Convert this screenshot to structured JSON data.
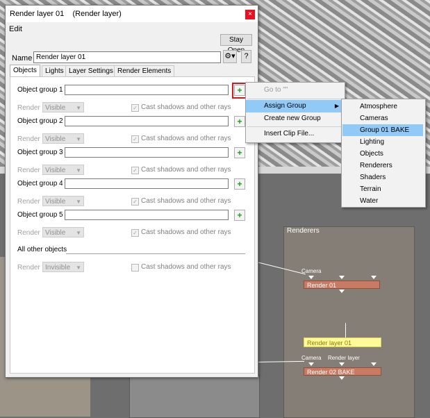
{
  "dialog": {
    "title": "Render layer 01    (Render layer)",
    "close_glyph": "×",
    "menu_edit": "Edit",
    "stay_open": "Stay Open",
    "name_label": "Name",
    "name_value": "Render layer 01",
    "gear_glyph": "⚙▾",
    "help_glyph": "?",
    "tabs": [
      {
        "label": "Objects",
        "active": true
      },
      {
        "label": "Lights"
      },
      {
        "label": "Layer Settings"
      },
      {
        "label": "Render Elements"
      }
    ],
    "render_label": "Render",
    "cast_shadows_label": "Cast shadows and other rays",
    "groups": [
      {
        "label": "Object group 1",
        "render": "Visible",
        "cast": true
      },
      {
        "label": "Object group 2",
        "render": "Visible",
        "cast": true
      },
      {
        "label": "Object group 3",
        "render": "Visible",
        "cast": true
      },
      {
        "label": "Object group 4",
        "render": "Visible",
        "cast": true
      },
      {
        "label": "Object group 5",
        "render": "Visible",
        "cast": true
      }
    ],
    "all_other": {
      "label": "All other objects",
      "render": "Invisible",
      "cast": false
    },
    "add_glyph": "+"
  },
  "context_menu": {
    "items": [
      {
        "label": "Go to \"\"",
        "disabled": true
      },
      {
        "label": "Assign Group",
        "submenu": true,
        "hover": true
      },
      {
        "label": "Create new Group"
      },
      {
        "label": "Insert Clip File..."
      }
    ],
    "submenu_arrow": "▶"
  },
  "submenu": {
    "items": [
      "Atmosphere",
      "Cameras",
      "Group 01 BAKE",
      "Lighting",
      "Objects",
      "Renderers",
      "Shaders",
      "Terrain",
      "Water"
    ],
    "hover_index": 2
  },
  "node_editor": {
    "renderers_title": "Renderers",
    "node1": {
      "port": "Camera",
      "label": "Render 01"
    },
    "node_yellow": "Render layer 01",
    "node2": {
      "port1": "Camera",
      "port2": "Render layer",
      "label": "Render 02 BAKE"
    }
  },
  "colors": {
    "accent_red": "#d9141b",
    "menu_hover": "#91c9f7",
    "node": "#c97a63",
    "node_yellow": "#fffa99"
  }
}
